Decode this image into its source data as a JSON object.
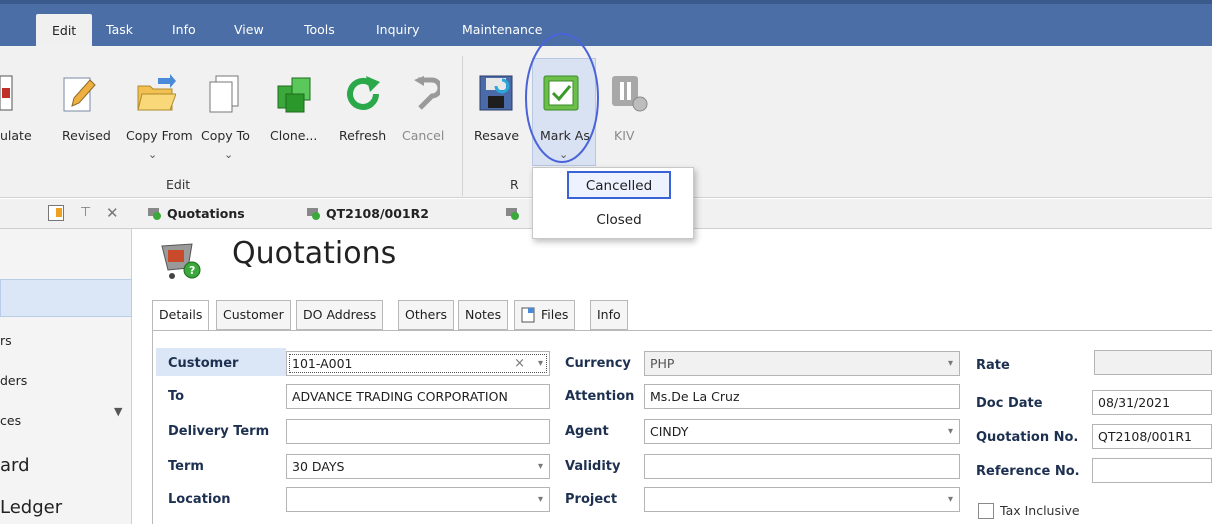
{
  "menu": {
    "tabs": [
      "Edit",
      "Task",
      "Info",
      "View",
      "Tools",
      "Inquiry",
      "Maintenance"
    ]
  },
  "ribbon": {
    "buttons": {
      "calculate": "ulate",
      "revised": "Revised",
      "copy_from": "Copy From",
      "copy_to": "Copy To",
      "clone": "Clone...",
      "refresh": "Refresh",
      "cancel": "Cancel",
      "resave": "Resave",
      "mark_as": "Mark As",
      "kiv": "KIV"
    },
    "groups": {
      "edit": "Edit",
      "r": "R"
    }
  },
  "mark_as_menu": {
    "items": [
      "Cancelled",
      "Closed"
    ]
  },
  "doc_tabs": [
    "Quotations",
    "QT2108/001R2"
  ],
  "left_nav": {
    "items": [
      "rs",
      "ders",
      "ces",
      "ard",
      "Ledger"
    ]
  },
  "page": {
    "title": "Quotations"
  },
  "detail_tabs": [
    "Details",
    "Customer",
    "DO Address",
    "Others",
    "Notes",
    "Files",
    "Info"
  ],
  "form": {
    "customer": {
      "label": "Customer",
      "value": "101-A001"
    },
    "to": {
      "label": "To",
      "value": "ADVANCE TRADING CORPORATION"
    },
    "delivery_term": {
      "label": "Delivery Term",
      "value": ""
    },
    "term": {
      "label": "Term",
      "value": "30 DAYS"
    },
    "location": {
      "label": "Location",
      "value": ""
    },
    "currency": {
      "label": "Currency",
      "value": "PHP"
    },
    "attention": {
      "label": "Attention",
      "value": "Ms.De La Cruz"
    },
    "agent": {
      "label": "Agent",
      "value": "CINDY"
    },
    "validity": {
      "label": "Validity",
      "value": ""
    },
    "project": {
      "label": "Project",
      "value": ""
    },
    "rate": {
      "label": "Rate",
      "value": ""
    },
    "doc_date": {
      "label": "Doc Date",
      "value": "08/31/2021"
    },
    "quotation_no": {
      "label": "Quotation No.",
      "value": "QT2108/001R1"
    },
    "reference_no": {
      "label": "Reference No.",
      "value": ""
    },
    "tax_inclusive": {
      "label": "Tax Inclusive",
      "checked": false
    }
  },
  "colors": {
    "menubar": "#4a6ea5",
    "highlight_circle": "#4a63d8",
    "label_bg": "#dbe7f6",
    "label_text": "#1e3050"
  }
}
